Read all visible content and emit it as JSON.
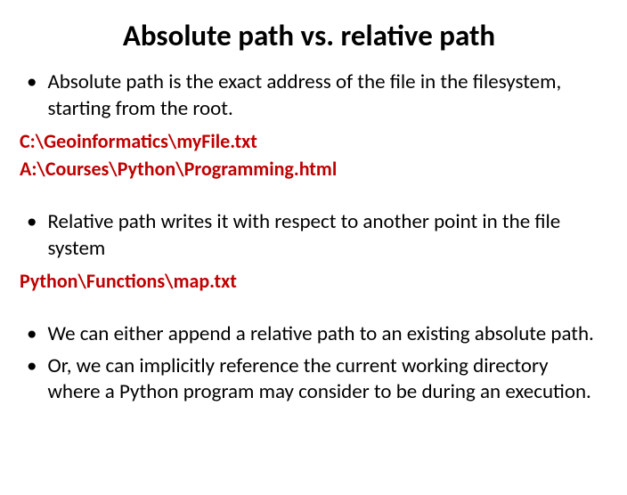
{
  "title": "Absolute path vs. relative path",
  "bullets": {
    "b1": "Absolute path is the exact address of the file in the filesystem, starting from the root.",
    "b2": "Relative path writes it with respect to another point in the file system",
    "b3": "We can either append a relative path to an existing absolute path.",
    "b4": "Or, we can implicitly reference the current working directory where a Python program may consider to be during an execution."
  },
  "paths": {
    "p1": "C:\\Geoinformatics\\myFile.txt",
    "p2": "A:\\Courses\\Python\\Programming.html",
    "p3": "Python\\Functions\\map.txt"
  }
}
